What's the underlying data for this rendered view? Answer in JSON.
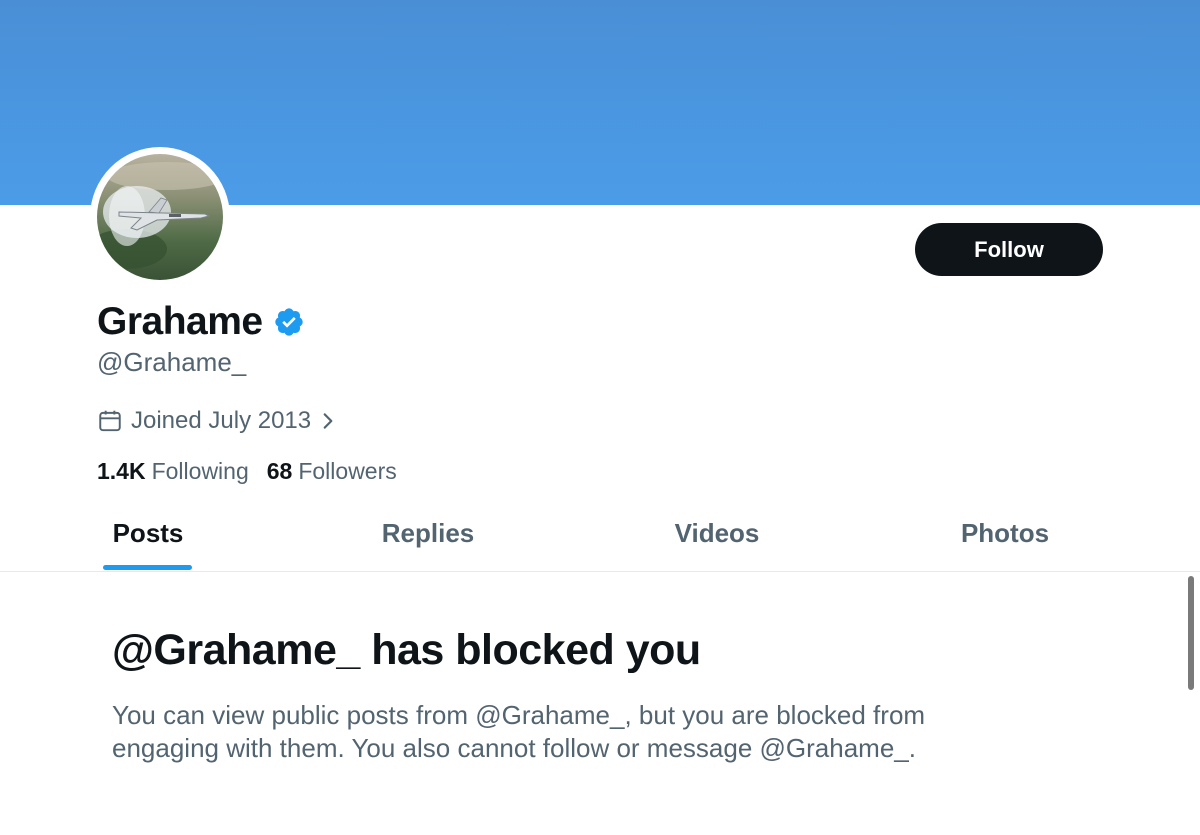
{
  "profile": {
    "display_name": "Grahame",
    "handle": "@Grahame_",
    "joined": "Joined July 2013",
    "verified": true,
    "following_count": "1.4K",
    "following_label": "Following",
    "followers_count": "68",
    "followers_label": "Followers"
  },
  "actions": {
    "follow_label": "Follow"
  },
  "tabs": [
    {
      "label": "Posts",
      "active": true
    },
    {
      "label": "Replies",
      "active": false
    },
    {
      "label": "Videos",
      "active": false
    },
    {
      "label": "Photos",
      "active": false
    }
  ],
  "blocked": {
    "title": "@Grahame_ has blocked you",
    "description": "You can view public posts from @Grahame_, but you are blocked from engaging with them. You also cannot follow or message @Grahame_."
  },
  "icons": {
    "verified": "verified-badge-icon",
    "calendar": "calendar-icon",
    "chevron": "chevron-right-icon"
  },
  "colors": {
    "banner": "#4b9ce8",
    "accent": "#1d9bf0",
    "text_primary": "#0f1419",
    "text_secondary": "#536471",
    "button_bg": "#0f1419"
  }
}
